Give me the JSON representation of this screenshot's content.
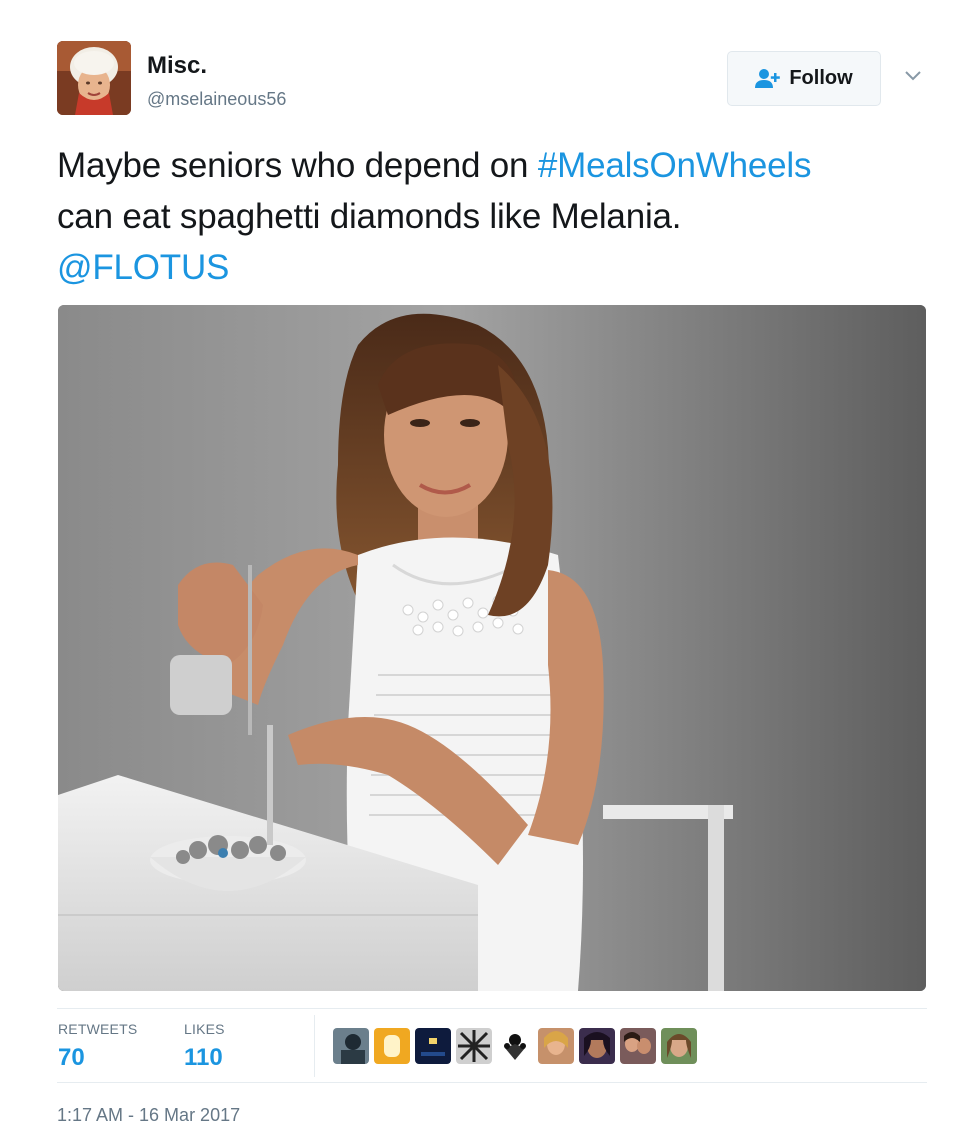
{
  "user": {
    "display_name": "Misc.",
    "handle": "@mselaineous56"
  },
  "follow": {
    "label": "Follow",
    "icon": "add-user-icon"
  },
  "menu": {
    "icon": "chevron-down-icon"
  },
  "tweet": {
    "line1_text": "Maybe seniors who depend on ",
    "line1_hashtag": "#MealsOnWheels",
    "line2_text": "can eat spaghetti diamonds like Melania.",
    "line3_mention": "@FLOTUS"
  },
  "stats": {
    "retweets_label": "RETWEETS",
    "retweets_value": "70",
    "likes_label": "LIKES",
    "likes_value": "110"
  },
  "timestamp": "1:17 AM - 16 Mar 2017",
  "colors": {
    "link": "#1b95e0",
    "text": "#14171a",
    "secondary": "#657786"
  }
}
